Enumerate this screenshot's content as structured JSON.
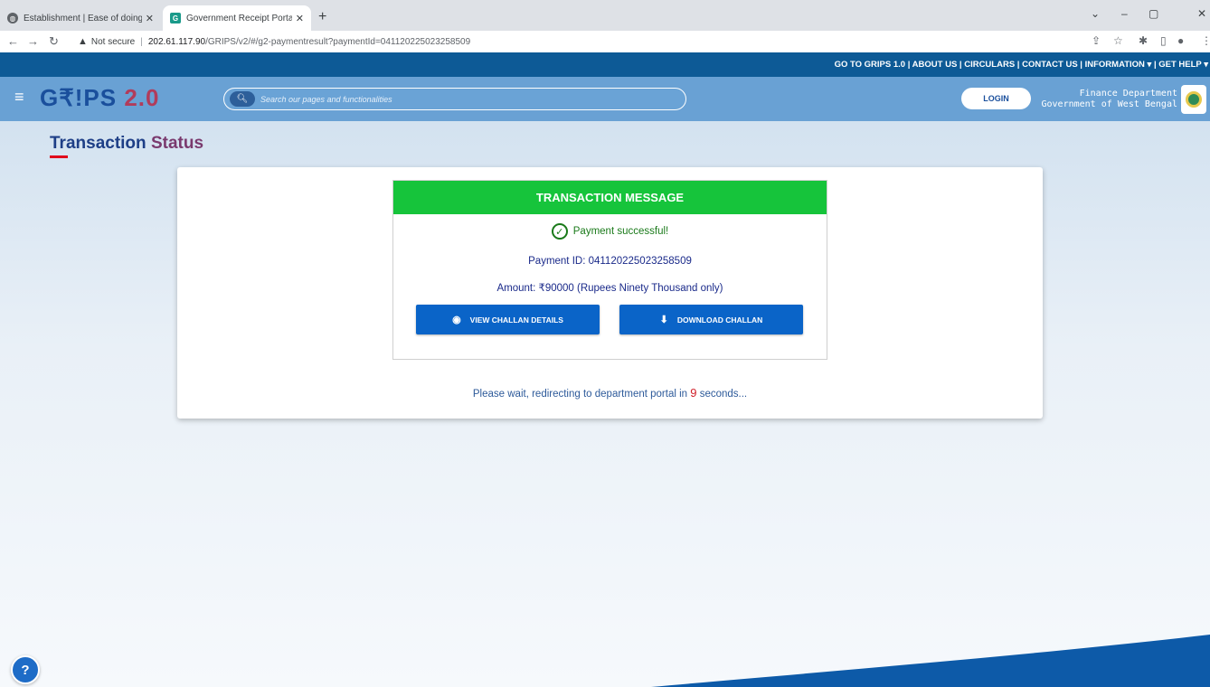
{
  "browser": {
    "tabs": [
      {
        "title": "Establishment | Ease of doing bu",
        "close": "✕"
      },
      {
        "title": "Government Receipt Portal Syste",
        "close": "✕"
      }
    ],
    "new_tab": "+",
    "url_warning": "Not secure",
    "url_separator": "|",
    "url_host": "202.61.117.90",
    "url_path": "/GRIPS/v2/#/g2-paymentresult?paymentId=041120225023258509"
  },
  "topbar": {
    "links": "GO TO GRIPS 1.0 | ABOUT US | CIRCULARS | CONTACT US | INFORMATION ▾ | GET HELP ▾"
  },
  "header": {
    "logo_g": "G₹!PS",
    "logo_version": "2.0",
    "search_placeholder": "Search our pages and functionalities",
    "login_label": "LOGIN",
    "dept_line1": "Finance Department",
    "dept_line2": "Government of West Bengal"
  },
  "page": {
    "title_part1": "Transaction",
    "title_part2": "Status"
  },
  "transaction": {
    "header": "TRANSACTION MESSAGE",
    "status": "Payment successful!",
    "payment_id": "Payment ID: 041120225023258509",
    "amount": "Amount: ₹90000 (Rupees Ninety Thousand only)",
    "view_button": "VIEW CHALLAN DETAILS",
    "download_button": "DOWNLOAD CHALLAN"
  },
  "redirect": {
    "prefix": "Please wait, redirecting to department portal in",
    "seconds": "9",
    "suffix": "seconds..."
  },
  "colors": {
    "topbar": "#0d5a96",
    "header": "#69a1d4",
    "success_header": "#16c43b",
    "button": "#0a64c8"
  },
  "icons": [
    "globe-icon",
    "grips-favicon-icon",
    "back-icon",
    "forward-icon",
    "reload-icon",
    "warning-icon",
    "share-icon",
    "star-icon",
    "extensions-icon",
    "sidebar-icon",
    "profile-icon",
    "menu-icon",
    "hamburger-icon",
    "search-icon",
    "emblem-icon",
    "check-circle-icon",
    "eye-icon",
    "download-icon",
    "help-icon"
  ]
}
